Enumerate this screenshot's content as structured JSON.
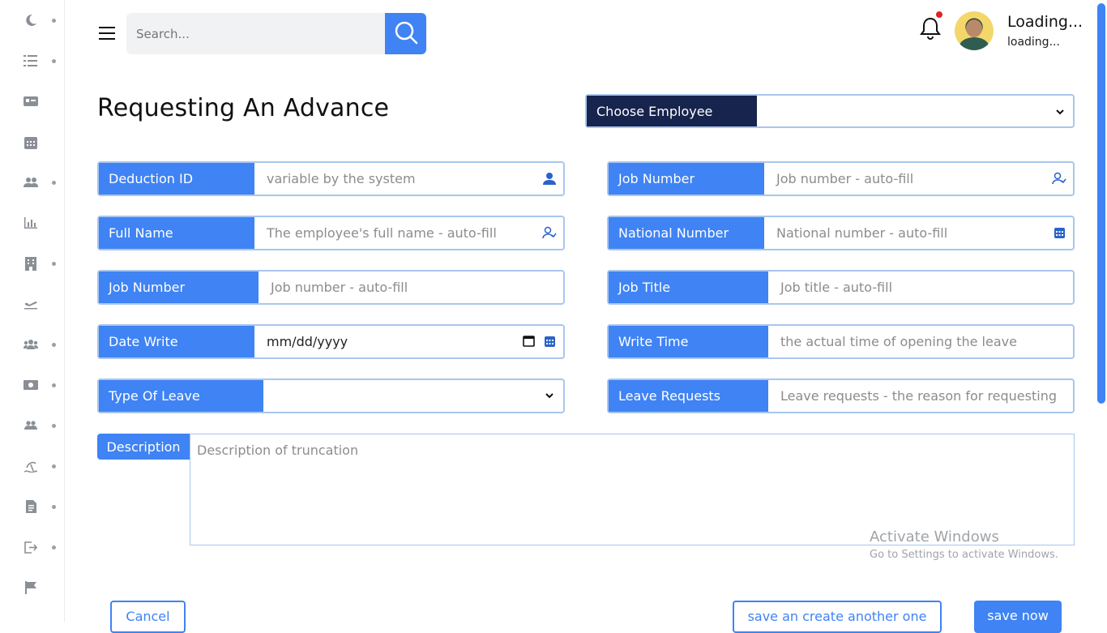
{
  "header": {
    "search_placeholder": "Search...",
    "user_name": "Loading...",
    "user_status": "loading..."
  },
  "page": {
    "title": "Requesting An Advance",
    "choose_employee_label": "Choose Employee",
    "choose_employee_value": ""
  },
  "fields": {
    "deduction_id": {
      "label": "Deduction ID",
      "placeholder": "variable by the system"
    },
    "job_number_right": {
      "label": "Job Number",
      "placeholder": "Job number - auto-fill"
    },
    "full_name": {
      "label": "Full Name",
      "placeholder": "The employee's full name - auto-fill"
    },
    "national_number": {
      "label": "National Number",
      "placeholder": "National number - auto-fill"
    },
    "job_number_left": {
      "label": "Job Number",
      "placeholder": "Job number - auto-fill"
    },
    "job_title": {
      "label": "Job Title",
      "placeholder": "Job title - auto-fill"
    },
    "date_write": {
      "label": "Date Write",
      "value": "mm/dd/yyyy"
    },
    "write_time": {
      "label": "Write Time",
      "placeholder": "the actual time of opening the leave"
    },
    "type_of_leave": {
      "label": "Type Of Leave",
      "value": ""
    },
    "leave_requests": {
      "label": "Leave Requests",
      "placeholder": "Leave requests - the reason for requesting"
    },
    "description": {
      "label": "Description",
      "placeholder": "Description of truncation"
    }
  },
  "watermark": {
    "title": "Activate Windows",
    "subtitle": "Go to Settings to activate Windows."
  },
  "buttons": {
    "cancel": "Cancel",
    "save_another": "save an create another one",
    "save_now": "save now"
  },
  "colors": {
    "accent": "#3f83f4",
    "dark_label": "#17244d",
    "border": "#a9c6ee",
    "notification": "#e02424"
  },
  "sidebar": {
    "icons": [
      "moon-icon",
      "checklist-icon",
      "id-card-icon",
      "calendar-icon",
      "users-icon",
      "chart-icon",
      "building-icon",
      "plane-icon",
      "team-icon",
      "money-icon",
      "group-icon",
      "beach-icon",
      "document-icon",
      "logout-icon",
      "flag-icon"
    ]
  }
}
